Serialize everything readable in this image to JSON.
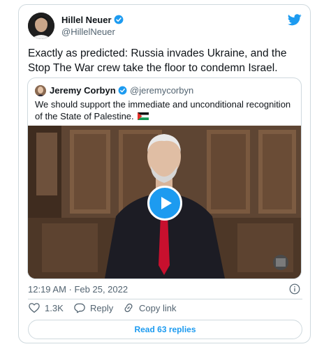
{
  "tweet": {
    "author_name": "Hillel Neuer",
    "author_handle": "@HillelNeuer",
    "text": "Exactly as predicted: Russia invades Ukraine, and the Stop The War crew take the floor to condemn Israel.",
    "timestamp": "12:19 AM · Feb 25, 2022"
  },
  "quote": {
    "author_name": "Jeremy Corbyn",
    "author_handle": "@jeremycorbyn",
    "text": "We should support the immediate and unconditional recognition of the State of Palestine."
  },
  "actions": {
    "like_count": "1.3K",
    "reply_label": "Reply",
    "copy_link_label": "Copy link"
  },
  "read_replies_label": "Read 63 replies",
  "colors": {
    "accent": "#1d9bf0",
    "text_primary": "#0f1419",
    "text_secondary": "#536471",
    "border": "#cfd9de"
  },
  "icons": [
    "verified-badge-icon",
    "twitter-bird-icon",
    "palestine-flag-icon",
    "play-icon",
    "info-icon",
    "heart-icon",
    "reply-icon",
    "copy-link-icon"
  ]
}
